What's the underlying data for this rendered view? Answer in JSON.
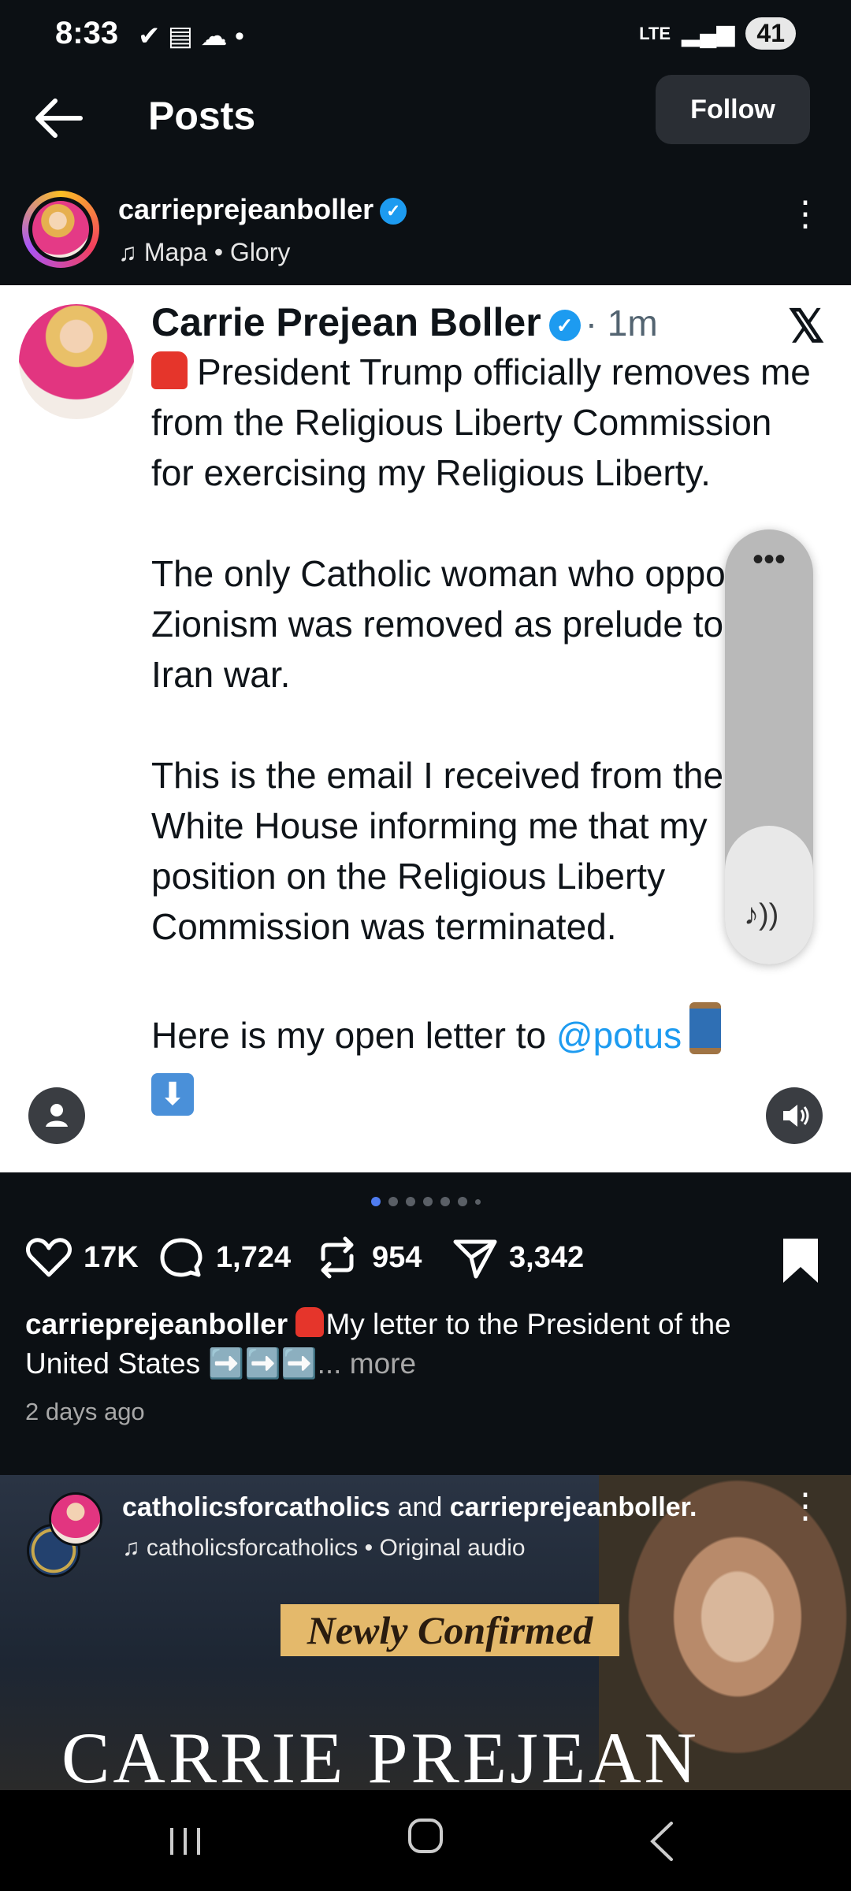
{
  "status_bar": {
    "time": "8:33",
    "network": "LTE",
    "battery": "41"
  },
  "header": {
    "title": "Posts",
    "follow_label": "Follow"
  },
  "post": {
    "username": "carrieprejeanboller",
    "music": "Mapa • Glory",
    "tweet": {
      "author": "Carrie Prejean Boller",
      "time": "· 1m",
      "para1": "President Trump officially removes me from the Religious Liberty Commission for exercising my Religious Liberty.",
      "para2": "The only Catholic woman who opposes Zionism was removed as prelude to the Iran war.",
      "para3": "This is the email I received from the White House informing me that my position on the Religious Liberty Commission was terminated.",
      "para4_prefix": "Here is my open letter to ",
      "mention": "@potus"
    },
    "likes": "17K",
    "comments": "1,724",
    "reposts": "954",
    "shares": "3,342",
    "caption_user": "carrieprejeanboller",
    "caption_text": "My letter to the President of the United States ➡️➡️➡️",
    "caption_more": "... more",
    "time_ago": "2 days ago"
  },
  "next_post": {
    "user1": "catholicsforcatholics",
    "joiner": " and ",
    "user2": "carrieprejeanboller.",
    "audio": "catholicsforcatholics • Original audio",
    "banner": "Newly Confirmed",
    "headline": "CARRIE PREJEAN"
  },
  "icons": {
    "back": "arrow-left-icon",
    "verified": "verified-badge-icon",
    "music": "music-note-icon",
    "x_logo": "x-logo-icon",
    "like": "heart-icon",
    "comment": "comment-icon",
    "repost": "repost-icon",
    "share": "send-icon",
    "bookmark": "bookmark-icon"
  },
  "colors": {
    "background": "#0c1014",
    "accent_blue": "#1d9bf0",
    "follow_button": "#2a2e34"
  }
}
